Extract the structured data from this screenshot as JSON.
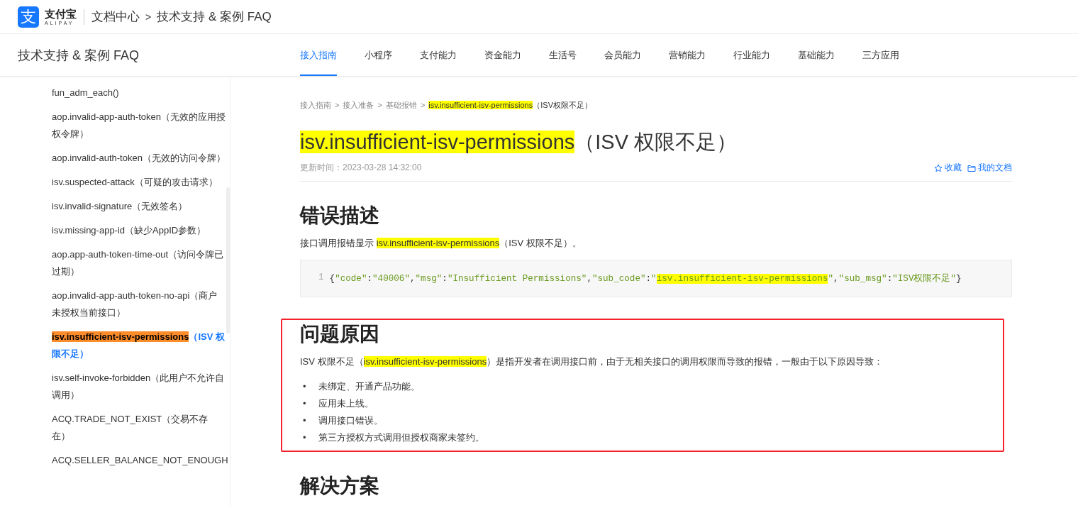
{
  "header": {
    "logo_mark": "支",
    "logo_name": "支付宝",
    "logo_sub": "ALIPAY",
    "breadcrumb": [
      "文档中心",
      "技术支持 & 案例 FAQ"
    ],
    "separator": ">"
  },
  "navbar": {
    "title": "技术支持 & 案例 FAQ",
    "tabs": [
      {
        "label": "接入指南",
        "selected": true
      },
      {
        "label": "小程序",
        "selected": false
      },
      {
        "label": "支付能力",
        "selected": false
      },
      {
        "label": "资金能力",
        "selected": false
      },
      {
        "label": "生活号",
        "selected": false
      },
      {
        "label": "会员能力",
        "selected": false
      },
      {
        "label": "营销能力",
        "selected": false
      },
      {
        "label": "行业能力",
        "selected": false
      },
      {
        "label": "基础能力",
        "selected": false
      },
      {
        "label": "三方应用",
        "selected": false
      }
    ]
  },
  "sidebar": {
    "items": [
      {
        "code": "fun_adm_each()",
        "selected": false
      },
      {
        "code": "aop.invalid-app-auth-token",
        "desc": "（无效的应用授权令牌）",
        "selected": false
      },
      {
        "code": "aop.invalid-auth-token",
        "desc": "（无效的访问令牌）",
        "selected": false
      },
      {
        "code": "isv.suspected-attack",
        "desc": "（可疑的攻击请求）",
        "selected": false
      },
      {
        "code": "isv.invalid-signature",
        "desc": "（无效签名）",
        "selected": false
      },
      {
        "code": "isv.missing-app-id",
        "desc": "（缺少AppID参数）",
        "selected": false
      },
      {
        "code": "aop.app-auth-token-time-out",
        "desc": "（访问令牌已过期）",
        "selected": false
      },
      {
        "code": "aop.invalid-app-auth-token-no-api",
        "desc": "（商户未授权当前接口）",
        "selected": false
      },
      {
        "code": "isv.insufficient-isv-permissions",
        "desc": "（ISV 权限不足）",
        "selected": true
      },
      {
        "code": "isv.self-invoke-forbidden",
        "desc": "（此用户不允许自调用）",
        "selected": false
      },
      {
        "code": "ACQ.TRADE_NOT_EXIST",
        "desc": "（交易不存在）",
        "selected": false
      },
      {
        "code": "ACQ.SELLER_BALANCE_NOT_ENOUGH",
        "selected": false
      }
    ]
  },
  "article": {
    "breadcrumb": [
      {
        "text": "接入指南"
      },
      {
        "text": "接入准备"
      },
      {
        "text": "基础报错"
      },
      {
        "text": "isv.insufficient-isv-permissions",
        "highlight": true,
        "suffix": "（ISV权限不足）"
      }
    ],
    "breadcrumb_separator": ">",
    "title": [
      {
        "text": "isv.insufficient-isv-permissions",
        "highlight": true
      },
      {
        "text": "（ISV 权限不足）"
      }
    ],
    "updated": "更新时间：2023-03-28 14:32:00",
    "actions": [
      {
        "kind": "star",
        "label": "收藏"
      },
      {
        "kind": "folder",
        "label": "我的文档"
      }
    ],
    "sections": [
      {
        "heading": "错误描述",
        "blocks": [
          {
            "kind": "paragraph",
            "segments": [
              {
                "text": "接口调用报错显示 "
              },
              {
                "text": "isv.insufficient-isv-permissions",
                "highlight": true
              },
              {
                "text": "（ISV 权限不足）。"
              }
            ]
          },
          {
            "kind": "code",
            "line_number": "1",
            "tokens": [
              {
                "kind": "punct",
                "text": "{"
              },
              {
                "kind": "string",
                "text": "\"code\""
              },
              {
                "kind": "punct",
                "text": ":"
              },
              {
                "kind": "string",
                "text": "\"40006\""
              },
              {
                "kind": "punct",
                "text": ","
              },
              {
                "kind": "string",
                "text": "\"msg\""
              },
              {
                "kind": "punct",
                "text": ":"
              },
              {
                "kind": "string",
                "text": "\"Insufficient Permissions\""
              },
              {
                "kind": "punct",
                "text": ","
              },
              {
                "kind": "string",
                "text": "\"sub_code\""
              },
              {
                "kind": "punct",
                "text": ":"
              },
              {
                "kind": "string",
                "text": "\""
              },
              {
                "kind": "string",
                "text": "isv.insufficient-isv-permissions",
                "highlight": true
              },
              {
                "kind": "string",
                "text": "\""
              },
              {
                "kind": "punct",
                "text": ","
              },
              {
                "kind": "string",
                "text": "\"sub_msg\""
              },
              {
                "kind": "punct",
                "text": ":"
              },
              {
                "kind": "string",
                "text": "\"ISV权限不足\""
              },
              {
                "kind": "punct",
                "text": "}"
              }
            ]
          }
        ]
      },
      {
        "heading": "问题原因",
        "outlined": true,
        "blocks": [
          {
            "kind": "paragraph",
            "segments": [
              {
                "text": "ISV 权限不足（"
              },
              {
                "text": "isv.insufficient-isv-permissions",
                "highlight": true
              },
              {
                "text": "）是指开发者在调用接口前，由于无相关接口的调用权限而导致的报错，一般由于以下原因导致："
              }
            ]
          },
          {
            "kind": "list",
            "marker": "•",
            "items": [
              "未绑定、开通产品功能。",
              "应用未上线。",
              "调用接口错误。",
              "第三方授权方式调用但授权商家未签约。"
            ]
          }
        ]
      },
      {
        "heading": "解决方案"
      }
    ]
  }
}
